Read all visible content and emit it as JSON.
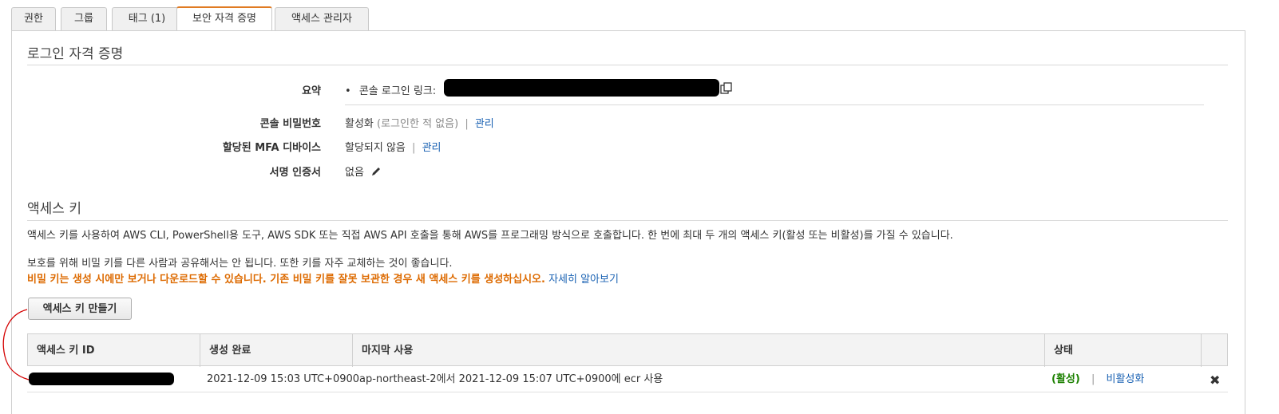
{
  "tabs": [
    {
      "label": "권한"
    },
    {
      "label": "그룹"
    },
    {
      "label": "태그 (1)"
    },
    {
      "label": "보안 자격 증명"
    },
    {
      "label": "액세스 관리자"
    }
  ],
  "signin": {
    "title": "로그인 자격 증명",
    "summary_label": "요약",
    "summary_text": "콘솔 로그인 링크:",
    "console_pw_label": "콘솔 비밀번호",
    "console_pw_value": "활성화",
    "console_pw_note": "(로그인한 적 없음)",
    "manage": "관리",
    "mfa_label": "할당된 MFA 디바이스",
    "mfa_value": "할당되지 않음",
    "signing_label": "서명 인증서",
    "signing_value": "없음"
  },
  "access": {
    "title": "액세스 키",
    "desc": "액세스 키를 사용하여 AWS CLI, PowerShell용 도구, AWS SDK 또는 직접 AWS API 호출을 통해 AWS를 프로그래밍 방식으로 호출합니다. 한 번에 최대 두 개의 액세스 키(활성 또는 비활성)를 가질 수 있습니다.",
    "protect": "보호를 위해 비밀 키를 다른 사람과 공유해서는 안 됩니다. 또한 키를 자주 교체하는 것이 좋습니다.",
    "warning": "비밀 키는 생성 시에만 보거나 다운로드할 수 있습니다. 기존 비밀 키를 잘못 보관한 경우 새 액세스 키를 생성하십시오.",
    "learn_more": "자세히 알아보기",
    "create_button": "액세스 키 만들기",
    "columns": [
      "액세스 키 ID",
      "생성 완료",
      "마지막 사용",
      "상태"
    ],
    "rows": [
      {
        "created": "2021-12-09 15:03 UTC+0900",
        "last_used": "ap-northeast-2에서 2021-12-09 15:07 UTC+0900에 ecr 사용",
        "status": "(활성)",
        "deactivate": "비활성화",
        "delete_symbol": "✖"
      }
    ]
  },
  "colors": {
    "accent": "#e07b22",
    "link": "#1a62b3",
    "warning": "#dd6a00",
    "active": "#1d8102",
    "annotation": "#d40000"
  },
  "icons": [
    "copy-icon",
    "pencil-icon",
    "delete-icon"
  ]
}
